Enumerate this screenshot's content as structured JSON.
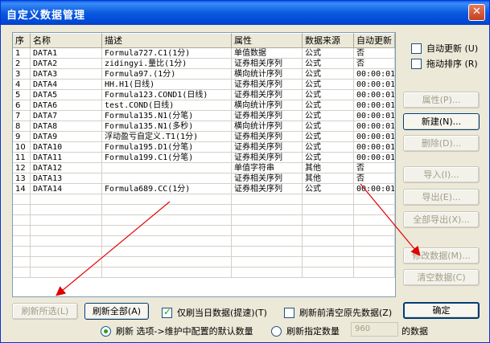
{
  "window": {
    "title": "自定义数据管理",
    "close_icon": "close-icon"
  },
  "grid": {
    "headers": [
      "序",
      "名称",
      "描述",
      "属性",
      "数据来源",
      "自动更新"
    ],
    "rows": [
      [
        "1",
        "DATA1",
        "Formula727.C1(1分)",
        "单值数据",
        "公式",
        "否"
      ],
      [
        "2",
        "DATA2",
        "zidingyi.量比(1分)",
        "证券相关序列",
        "公式",
        "否"
      ],
      [
        "3",
        "DATA3",
        "Formula97.(1分)",
        "横向统计序列",
        "公式",
        "00:00:01"
      ],
      [
        "4",
        "DATA4",
        "HH.H1(日线)",
        "证券相关序列",
        "公式",
        "00:00:01"
      ],
      [
        "5",
        "DATA5",
        "Formula123.COND1(日线)",
        "证券相关序列",
        "公式",
        "00:00:01"
      ],
      [
        "6",
        "DATA6",
        "test.COND(日线)",
        "横向统计序列",
        "公式",
        "00:00:01"
      ],
      [
        "7",
        "DATA7",
        "Formula135.N1(分笔)",
        "证券相关序列",
        "公式",
        "00:00:01"
      ],
      [
        "8",
        "DATA8",
        "Formula135.N1(多秒)",
        "横向统计序列",
        "公式",
        "00:00:01"
      ],
      [
        "9",
        "DATA9",
        "浮动盈亏自定义.T1(1分)",
        "证券相关序列",
        "公式",
        "00:00:01"
      ],
      [
        "10",
        "DATA10",
        "Formula195.D1(分笔)",
        "证券相关序列",
        "公式",
        "00:00:01"
      ],
      [
        "11",
        "DATA11",
        "Formula199.C1(分笔)",
        "证券相关序列",
        "公式",
        "00:00:01"
      ],
      [
        "12",
        "DATA12",
        "",
        "单值字符串",
        "其他",
        "否"
      ],
      [
        "13",
        "DATA13",
        "",
        "证券相关序列",
        "其他",
        "否"
      ],
      [
        "14",
        "DATA14",
        "Formula689.CC(1分)",
        "证券相关序列",
        "公式",
        "00:00:01"
      ]
    ],
    "empty_rows": 8
  },
  "right": {
    "auto_update": "自动更新 (U)",
    "drag_sort": "拖动排序 (R)",
    "properties": "属性(P)...",
    "new": "新建(N)...",
    "delete": "删除(D)...",
    "import": "导入(I)...",
    "export": "导出(E)...",
    "export_all": "全部导出(X)...",
    "modify": "修改数据(M)...",
    "clear": "清空数据(C)"
  },
  "bottom": {
    "refresh_selected": "刷新所选(L)",
    "refresh_all": "刷新全部(A)",
    "only_today": "仅刷当日数据(提速)(T)",
    "clear_before": "刷新前清空原先数据(Z)",
    "ok": "确定",
    "radio_default": "刷新 选项->维护中配置的默认数量",
    "radio_custom": "刷新指定数量",
    "count_value": "960",
    "count_suffix": "的数据"
  }
}
